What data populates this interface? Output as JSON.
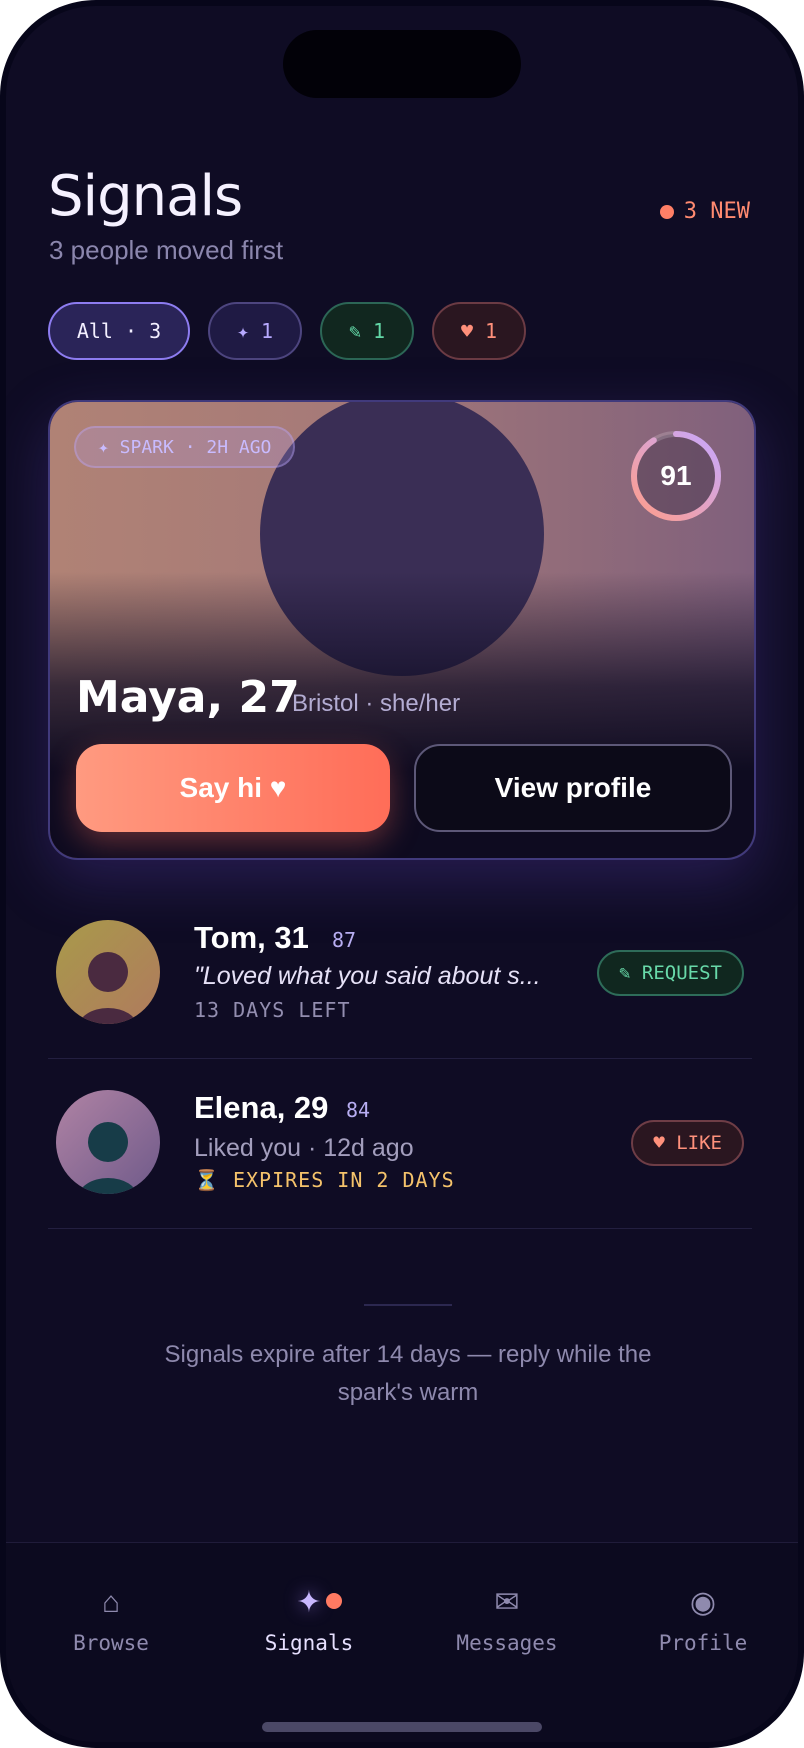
{
  "header": {
    "title": "Signals",
    "subtitle": "3 people moved first",
    "new_badge": "3 NEW"
  },
  "filters": [
    {
      "label": "All · 3",
      "active": true
    },
    {
      "label": "✦ 1"
    },
    {
      "label": "✎ 1"
    },
    {
      "label": "♥ 1"
    }
  ],
  "featured": {
    "tag": "✦ SPARK · 2H AGO",
    "score": "91",
    "score_fraction": 0.91,
    "name": "Maya, 27",
    "location": "Bristol · she/her",
    "primary_button": "Say hi ♥",
    "secondary_button": "View profile"
  },
  "signals": [
    {
      "name": "Tom, 31",
      "score": "87",
      "message": "\"Loved what you said about s...",
      "meta": "13 DAYS LEFT",
      "tag": "✎ REQUEST"
    },
    {
      "name": "Elena, 29",
      "score": "84",
      "message": "Liked you · 12d ago",
      "meta": "⏳ EXPIRES IN 2 DAYS",
      "tag": "♥ LIKE"
    }
  ],
  "footnote": "Signals expire after 14 days — reply while the spark's warm",
  "tabs": [
    {
      "label": "Browse",
      "icon": "⌂"
    },
    {
      "label": "Signals",
      "icon": "✦",
      "active": true
    },
    {
      "label": "Messages",
      "icon": "✉"
    },
    {
      "label": "Profile",
      "icon": "◉"
    }
  ],
  "colors": {
    "accent": "#8d7cf0",
    "coral": "#ff7a62",
    "request_green": "#62d7a6",
    "warning": "#f5c36b"
  }
}
